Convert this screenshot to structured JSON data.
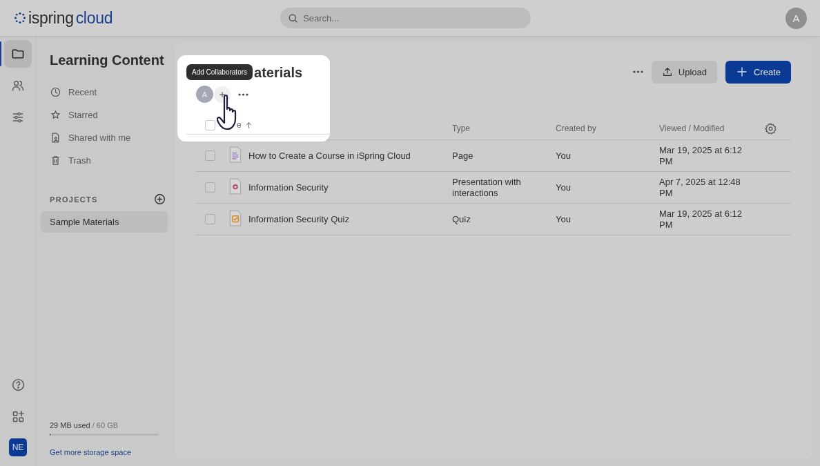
{
  "topbar": {
    "logo_left": "ispring",
    "logo_right": "cloud",
    "search": {
      "placeholder": "Search..."
    },
    "avatar": "A"
  },
  "rail": {
    "items": [
      {
        "kind": "folder",
        "selected": true
      },
      {
        "kind": "people",
        "selected": false
      },
      {
        "kind": "sliders",
        "selected": false
      }
    ],
    "bottom": [
      {
        "kind": "help"
      },
      {
        "kind": "apps"
      }
    ],
    "account": "NE"
  },
  "sidebar": {
    "title": "Learning Content",
    "items": [
      {
        "kind": "clock",
        "label": "Recent"
      },
      {
        "kind": "star",
        "label": "Starred"
      },
      {
        "kind": "shared",
        "label": "Shared with me"
      },
      {
        "kind": "trash",
        "label": "Trash"
      }
    ],
    "projects_heading": "PROJECTS",
    "projects": [
      {
        "label": "Sample Materials",
        "selected": true
      }
    ],
    "storage": {
      "used": "29 MB used",
      "total": " / 60 GB",
      "level": 0.0005
    },
    "storage_link": "Get more storage space"
  },
  "content": {
    "title": "aterials",
    "tooltip": "Add Collaborators",
    "collaborators": [
      {
        "initial": "A"
      }
    ],
    "upload": "Upload",
    "create": "Create",
    "table": {
      "select_all": {
        "checked": false
      },
      "columns": [
        {
          "label": "e",
          "sorted": true
        },
        {
          "label": "Type",
          "sorted": false
        },
        {
          "label": "Created by",
          "sorted": false
        },
        {
          "label": "Viewed / Modified",
          "sorted": false
        }
      ],
      "rows": [
        {
          "kind": "page",
          "checked": false,
          "name": "How to Create a Course in iSpring Cloud",
          "type": "Page",
          "created_by": "You",
          "modified": "Mar 19, 2025 at 6:12 PM"
        },
        {
          "kind": "presentation",
          "checked": false,
          "name": "Information Security",
          "type": "Presentation with interactions",
          "created_by": "You",
          "modified": "Apr 7, 2025 at 12:48 PM"
        },
        {
          "kind": "quiz",
          "checked": false,
          "name": "Information Security Quiz",
          "type": "Quiz",
          "created_by": "You",
          "modified": "Mar 19, 2025 at 6:12 PM"
        }
      ]
    }
  }
}
